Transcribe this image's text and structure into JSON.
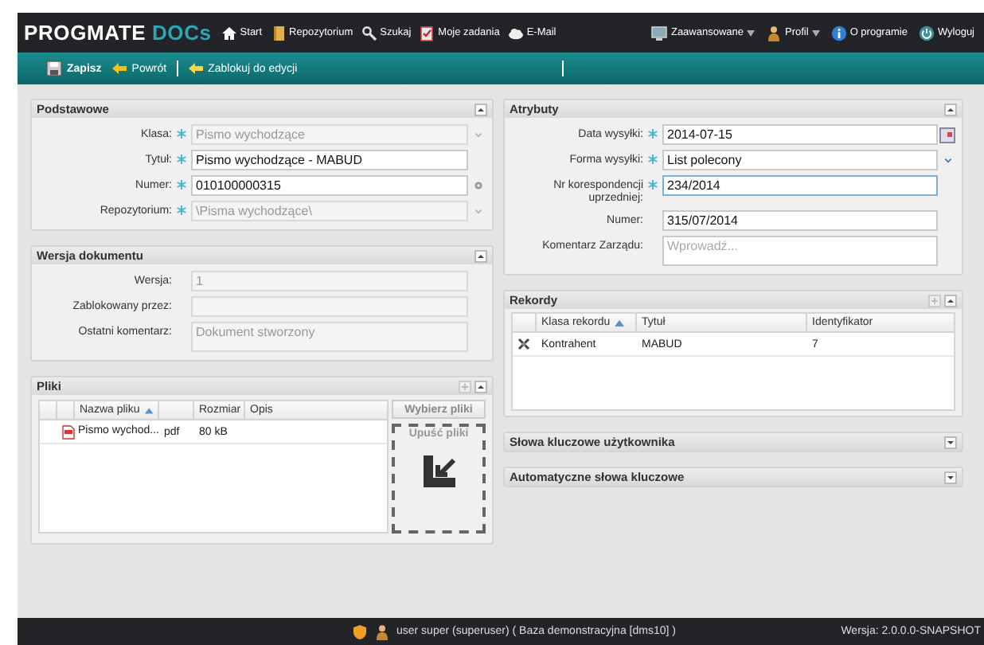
{
  "app": {
    "logo": "PROGMATE",
    "logo_accent": "DOCs"
  },
  "nav_left": [
    {
      "label": "Start"
    },
    {
      "label": "Repozytorium"
    },
    {
      "label": "Szukaj"
    },
    {
      "label": "Moje zadania"
    },
    {
      "label": "E-Mail"
    }
  ],
  "nav_right": [
    {
      "label": "Zaawansowane",
      "dropdown": true
    },
    {
      "label": "Profil",
      "dropdown": true
    },
    {
      "label": "O programie",
      "dropdown": false
    },
    {
      "label": "Wyloguj",
      "dropdown": false
    }
  ],
  "toolbar": [
    {
      "kind": "button",
      "label": "Zapisz",
      "bold": true
    },
    {
      "kind": "button",
      "label": "Powrót",
      "bold": false
    },
    {
      "kind": "separator"
    },
    {
      "kind": "button",
      "label": "Zablokuj do edycji",
      "bold": false
    },
    {
      "kind": "separator"
    }
  ],
  "left_panels": [
    {
      "kind": "form",
      "title": "Podstawowe",
      "expanded": true,
      "fields": [
        {
          "kind": "select",
          "label": "Klasa:",
          "required": true,
          "value": "Pismo wychodzące",
          "disabled": true,
          "focused": false
        },
        {
          "kind": "text",
          "label": "Tytuł:",
          "required": true,
          "value": "Pismo wychodzące - MABUD",
          "disabled": false,
          "focused": false
        },
        {
          "kind": "generator",
          "label": "Numer:",
          "required": true,
          "value": "010100000315",
          "disabled": false,
          "focused": false
        },
        {
          "kind": "select",
          "label": "Repozytorium:",
          "required": true,
          "value": "\\Pisma wychodzące\\",
          "disabled": true,
          "focused": false
        }
      ]
    },
    {
      "kind": "form",
      "title": "Wersja dokumentu",
      "expanded": true,
      "fields": [
        {
          "kind": "text",
          "label": "Wersja:",
          "required": false,
          "value": "1",
          "disabled": true,
          "focused": false
        },
        {
          "kind": "text",
          "label": "Zablokowany przez:",
          "required": false,
          "disabled": true,
          "focused": false
        },
        {
          "kind": "textarea",
          "label": "Ostatni komentarz:",
          "required": false,
          "value": "Dokument stworzony",
          "disabled": true,
          "focused": false
        }
      ]
    },
    {
      "kind": "files",
      "title": "Pliki",
      "expanded": true,
      "columns": [
        {
          "sorted": false
        },
        {
          "sorted": false
        },
        {
          "label": "Nazwa pliku",
          "sorted": true
        },
        {
          "sorted": false
        },
        {
          "label": "Rozmiar",
          "sorted": false
        },
        {
          "label": "Opis",
          "sorted": false
        }
      ],
      "rows": [
        {
          "name": "Pismo wychod...",
          "type": "pdf",
          "size": "80 kB"
        }
      ],
      "choose_button": "Wybierz pliki",
      "drop_label": "Upuść pliki"
    }
  ],
  "right_panels": [
    {
      "kind": "form",
      "title": "Atrybuty",
      "expanded": true,
      "fields": [
        {
          "kind": "date",
          "label": "Data wysyłki:",
          "required": true,
          "value": "2014-07-15",
          "disabled": false,
          "focused": false
        },
        {
          "kind": "select",
          "label": "Forma wysyłki:",
          "required": true,
          "value": "List polecony",
          "disabled": false,
          "focused": false
        },
        {
          "kind": "text",
          "label": "Nr korespondencji uprzedniej:",
          "required": true,
          "value": "234/2014",
          "disabled": false,
          "focused": true
        },
        {
          "kind": "text",
          "label": "Numer:",
          "required": false,
          "value": "315/07/2014",
          "disabled": false,
          "focused": false
        },
        {
          "kind": "textarea",
          "label": "Komentarz Zarządu:",
          "required": false,
          "placeholder": "Wprowadź...",
          "disabled": false,
          "focused": false
        }
      ]
    },
    {
      "kind": "records",
      "title": "Rekordy",
      "expanded": true,
      "columns": [
        {
          "sorted": false
        },
        {
          "label": "Klasa rekordu",
          "sorted": true
        },
        {
          "label": "Tytuł",
          "sorted": false
        },
        {
          "label": "Identyfikator",
          "sorted": false
        }
      ],
      "rows": [
        {
          "class": "Kontrahent",
          "title": "MABUD",
          "id": "7"
        }
      ]
    },
    {
      "kind": "collapsed",
      "title": "Słowa kluczowe użytkownika",
      "expanded": false
    },
    {
      "kind": "collapsed",
      "title": "Automatyczne słowa kluczowe",
      "expanded": false
    }
  ],
  "status_bar": {
    "user": "user super (superuser) ( Baza demonstracyjna [dms10] )",
    "version": "Wersja: 2.0.0.0-SNAPSHOT"
  }
}
